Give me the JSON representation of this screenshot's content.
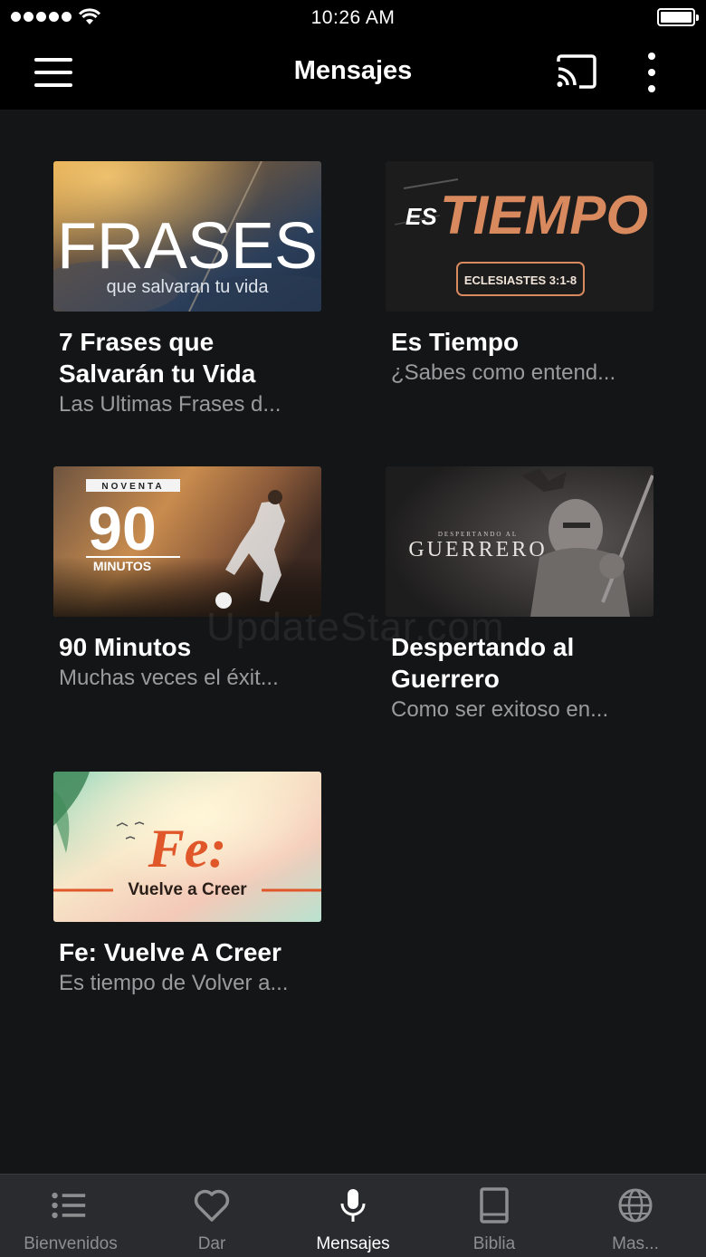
{
  "status": {
    "time": "10:26 AM"
  },
  "header": {
    "title": "Mensajes"
  },
  "thumb_text": {
    "frases_big": "FRASES",
    "frases_small": "que salvaran tu vida",
    "tiempo_es": "ES",
    "tiempo_big": "TIEMPO",
    "tiempo_ref": "ECLESIASTES 3:1-8",
    "ninety_top": "NOVENTA",
    "ninety_num": "90",
    "ninety_bottom": "MINUTOS",
    "guerrero_small": "DESPERTANDO AL",
    "guerrero_big": "GUERRERO",
    "fe_big": "Fe:",
    "fe_small": "Vuelve a Creer"
  },
  "cards": [
    {
      "title": "7 Frases que Salvarán tu Vida",
      "subtitle": "Las Ultimas Frases d..."
    },
    {
      "title": "Es Tiempo",
      "subtitle": "¿Sabes como entend..."
    },
    {
      "title": "90 Minutos",
      "subtitle": "Muchas veces el éxit..."
    },
    {
      "title": "Despertando al Guerrero",
      "subtitle": "Como ser exitoso en..."
    },
    {
      "title": "Fe: Vuelve A Creer",
      "subtitle": "Es tiempo de Volver a..."
    }
  ],
  "watermark": "UpdateStar.com",
  "tabs": [
    {
      "label": "Bienvenidos",
      "icon": "list-icon"
    },
    {
      "label": "Dar",
      "icon": "heart-icon"
    },
    {
      "label": "Mensajes",
      "icon": "microphone-icon",
      "active": true
    },
    {
      "label": "Biblia",
      "icon": "book-icon"
    },
    {
      "label": "Mas...",
      "icon": "globe-icon"
    }
  ],
  "colors": {
    "background": "#141517",
    "bar": "#000000",
    "tabbar": "#2a2b2e",
    "inactive": "#8d8e90",
    "subtitle": "#9a9b9d"
  }
}
